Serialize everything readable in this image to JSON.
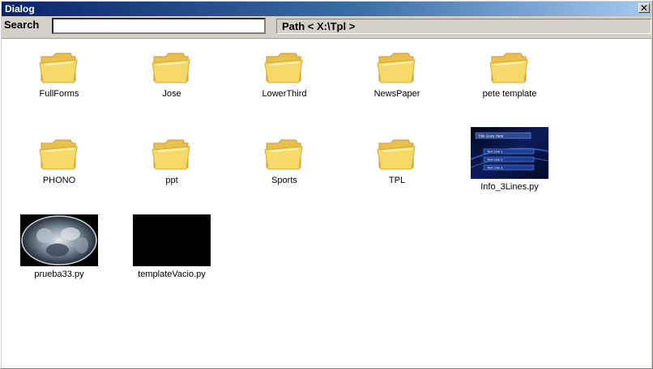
{
  "window": {
    "title": "Dialog",
    "close_glyph": "✕"
  },
  "toolbar": {
    "search_label": "Search",
    "search_value": "",
    "path_text": "Path < X:\\Tpl >"
  },
  "items": [
    {
      "label": "FullForms",
      "kind": "folder"
    },
    {
      "label": "Jose",
      "kind": "folder"
    },
    {
      "label": "LowerThird",
      "kind": "folder"
    },
    {
      "label": "NewsPaper",
      "kind": "folder"
    },
    {
      "label": "pete template",
      "kind": "folder"
    },
    {
      "label": "PHONO",
      "kind": "folder"
    },
    {
      "label": "ppt",
      "kind": "folder"
    },
    {
      "label": "Sports",
      "kind": "folder"
    },
    {
      "label": "TPL",
      "kind": "folder"
    },
    {
      "label": "Info_3Lines.py",
      "kind": "thumbnail",
      "thumb_title": "Title Goes Here",
      "thumb_lines": [
        "Text Line 1",
        "Text Line 2",
        "Text Line 3"
      ]
    },
    {
      "label": "prueba33.py",
      "kind": "thumbnail"
    },
    {
      "label": "templateVacio.py",
      "kind": "thumbnail"
    }
  ],
  "colors": {
    "titlebar_start": "#0a246a",
    "titlebar_end": "#a6caf0",
    "folder_fill": "#f7d96a",
    "folder_edge": "#d9a92e"
  }
}
